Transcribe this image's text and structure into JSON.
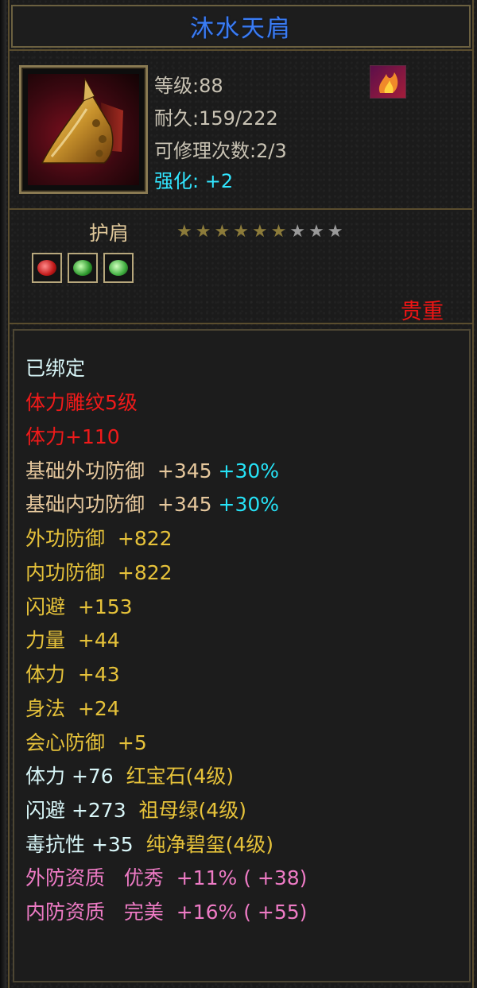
{
  "item": {
    "name": "沐水天肩",
    "level": "等级:88",
    "durability": "耐久:159/222",
    "repair": "可修理次数:2/3",
    "enhance_label": "强化:",
    "enhance_value": "+2",
    "type": "护肩",
    "rarity": "贵重",
    "stars_total": 9,
    "stars_filled": 6
  },
  "gems": [
    {
      "icon": "red-gem-icon",
      "color": "#d42a2a"
    },
    {
      "icon": "green-gem-icon",
      "color": "#3fae3f"
    },
    {
      "icon": "green-gem-icon",
      "color": "#4ab84a"
    }
  ],
  "attributes": {
    "bound": "已绑定",
    "engrave": "体力雕纹5级",
    "stamina": "体力+110",
    "base_ext_def": {
      "label": "基础外功防御",
      "value": "+345",
      "pct": "+30%"
    },
    "base_int_def": {
      "label": "基础内功防御",
      "value": "+345",
      "pct": "+30%"
    },
    "ext_def": "外功防御  +822",
    "int_def": "内功防御  +822",
    "dodge": "闪避  +153",
    "strength": "力量  +44",
    "stamina2": "体力  +43",
    "agility": "身法  +24",
    "crit_def": "会心防御  +5",
    "gem1": {
      "stat": "体力 +76",
      "name": "红宝石(4级)"
    },
    "gem2": {
      "stat": "闪避 +273",
      "name": "祖母绿(4级)"
    },
    "gem3": {
      "stat": "毒抗性 +35",
      "name": "纯净碧玺(4级)"
    },
    "quality1": "外防资质   优秀  +11% ( +38)",
    "quality2": "内防资质   完美  +16% ( +55)"
  },
  "colors": {
    "title": "#3a7cf4",
    "rarity": "#ee1515",
    "cyan": "#26e3f7",
    "yellow": "#e6c23a",
    "pink": "#ee7bc5"
  }
}
